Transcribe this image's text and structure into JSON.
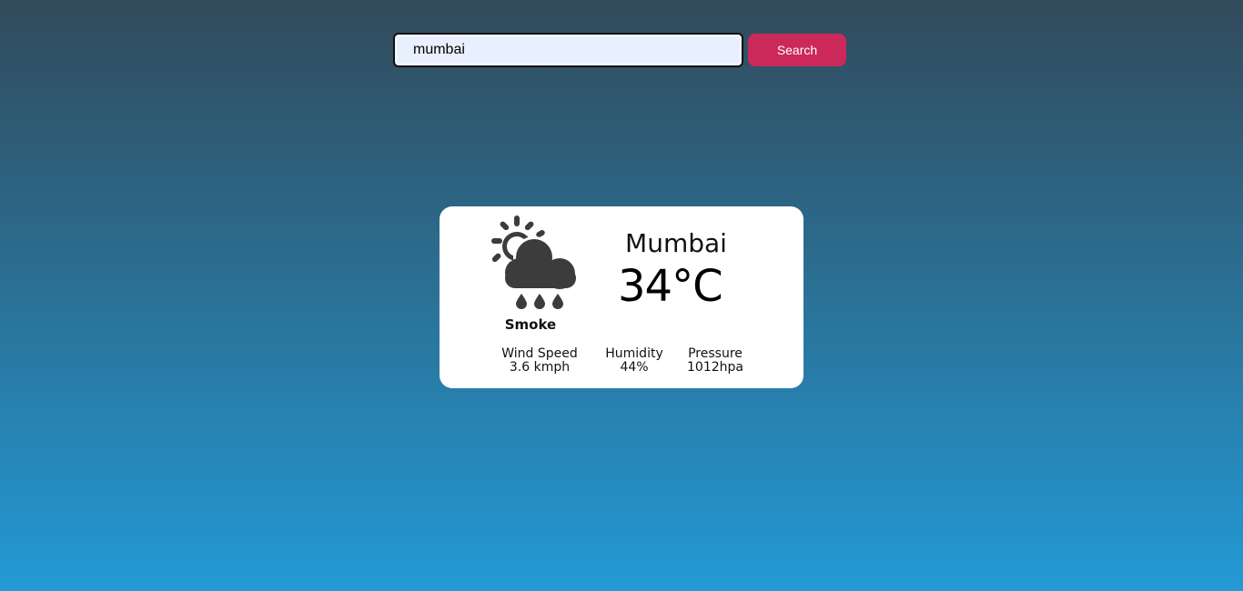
{
  "search": {
    "value": "mumbai",
    "button_label": "Search"
  },
  "weather": {
    "icon": "cloud-sun-rain-icon",
    "condition": "Smoke",
    "city": "Mumbai",
    "temperature": "34°C",
    "stats": {
      "wind": {
        "label": "Wind Speed",
        "value": "3.6 kmph"
      },
      "humidity": {
        "label": "Humidity",
        "value": "44%"
      },
      "pressure": {
        "label": "Pressure",
        "value": "1012hpa"
      }
    }
  },
  "colors": {
    "background_top": "#324a5b",
    "background_bottom": "#239ad6",
    "accent": "#cb295a",
    "input_background": "#e8f0fe",
    "card": "#ffffff",
    "icon": "#3c3c3c"
  }
}
